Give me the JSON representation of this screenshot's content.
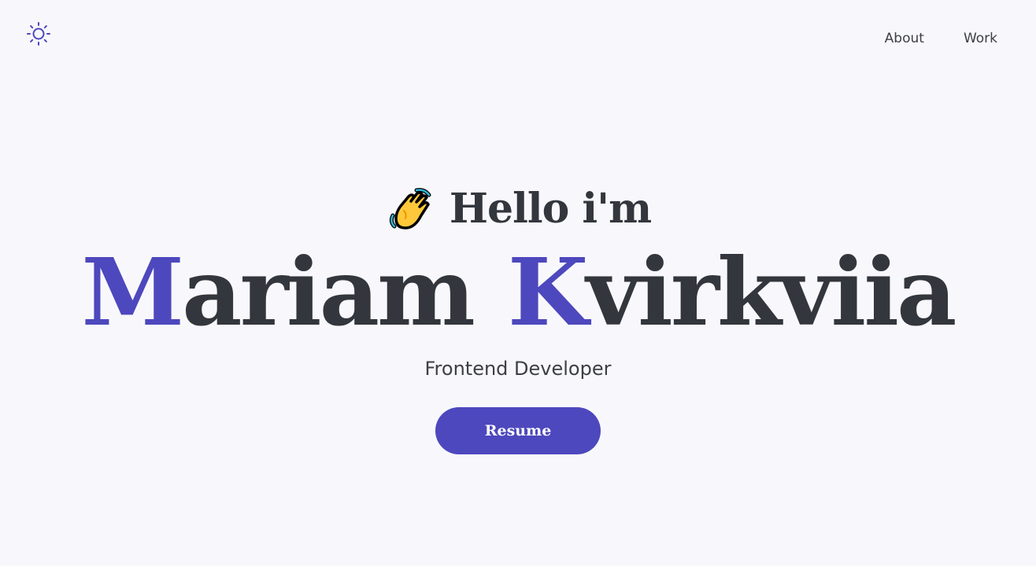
{
  "header": {
    "theme_toggle_icon": "sun-icon",
    "nav": [
      {
        "label": "About"
      },
      {
        "label": "Work"
      }
    ]
  },
  "hero": {
    "greeting_icon": "waving-hand-icon",
    "greeting": "Hello i'm",
    "name": {
      "first_initial": "M",
      "first_rest": "ariam",
      "last_initial": "K",
      "last_rest": "virkviia"
    },
    "role": "Frontend Developer",
    "resume_label": "Resume"
  },
  "colors": {
    "accent": "#4d48bd",
    "text": "#33373d",
    "background": "#f8f8fc"
  }
}
